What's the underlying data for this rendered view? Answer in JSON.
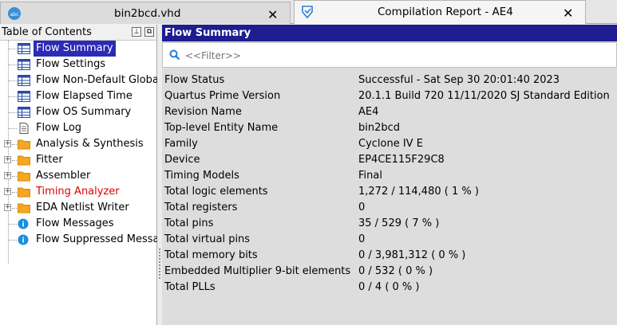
{
  "tabs": [
    {
      "title": "bin2bcd.vhd",
      "icon": "vhdl-file-icon",
      "active": false
    },
    {
      "title": "Compilation Report - AE4",
      "icon": "compilation-report-icon",
      "active": true
    }
  ],
  "toc": {
    "title": "Table of Contents",
    "items": [
      {
        "label": "Flow Summary",
        "icon": "table-icon",
        "expandable": false,
        "selected": true
      },
      {
        "label": "Flow Settings",
        "icon": "table-icon",
        "expandable": false
      },
      {
        "label": "Flow Non-Default Global",
        "icon": "table-icon",
        "expandable": false
      },
      {
        "label": "Flow Elapsed Time",
        "icon": "table-icon",
        "expandable": false
      },
      {
        "label": "Flow OS Summary",
        "icon": "table-icon",
        "expandable": false
      },
      {
        "label": "Flow Log",
        "icon": "document-icon",
        "expandable": false
      },
      {
        "label": "Analysis & Synthesis",
        "icon": "folder-icon",
        "expandable": true
      },
      {
        "label": "Fitter",
        "icon": "folder-icon",
        "expandable": true
      },
      {
        "label": "Assembler",
        "icon": "folder-icon",
        "expandable": true
      },
      {
        "label": "Timing Analyzer",
        "icon": "folder-icon",
        "expandable": true,
        "warning": true
      },
      {
        "label": "EDA Netlist Writer",
        "icon": "folder-icon",
        "expandable": true
      },
      {
        "label": "Flow Messages",
        "icon": "info-icon",
        "expandable": false
      },
      {
        "label": "Flow Suppressed Messag",
        "icon": "info-icon",
        "expandable": false
      }
    ]
  },
  "main": {
    "title": "Flow Summary",
    "filter_placeholder": "<<Filter>>",
    "rows": [
      {
        "key": "Flow Status",
        "value": "Successful - Sat Sep 30 20:01:40 2023"
      },
      {
        "key": "Quartus Prime Version",
        "value": "20.1.1 Build 720 11/11/2020 SJ Standard Edition"
      },
      {
        "key": "Revision Name",
        "value": "AE4"
      },
      {
        "key": "Top-level Entity Name",
        "value": "bin2bcd"
      },
      {
        "key": "Family",
        "value": "Cyclone IV E"
      },
      {
        "key": "Device",
        "value": "EP4CE115F29C8"
      },
      {
        "key": "Timing Models",
        "value": "Final"
      },
      {
        "key": "Total logic elements",
        "value": "1,272 / 114,480 ( 1 % )"
      },
      {
        "key": "Total registers",
        "value": "0"
      },
      {
        "key": "Total pins",
        "value": "35 / 529 ( 7 % )"
      },
      {
        "key": "Total virtual pins",
        "value": "0"
      },
      {
        "key": "Total memory bits",
        "value": "0 / 3,981,312 ( 0 % )"
      },
      {
        "key": "Embedded Multiplier 9-bit elements",
        "value": "0 / 532 ( 0 % )"
      },
      {
        "key": "Total PLLs",
        "value": "0 / 4 ( 0 % )"
      }
    ]
  },
  "colors": {
    "header_blue": "#1d1d8f",
    "selection_blue": "#2b2bb6",
    "warning_red": "#e00000",
    "folder_orange": "#f5a623",
    "info_blue": "#1a8fe0"
  }
}
